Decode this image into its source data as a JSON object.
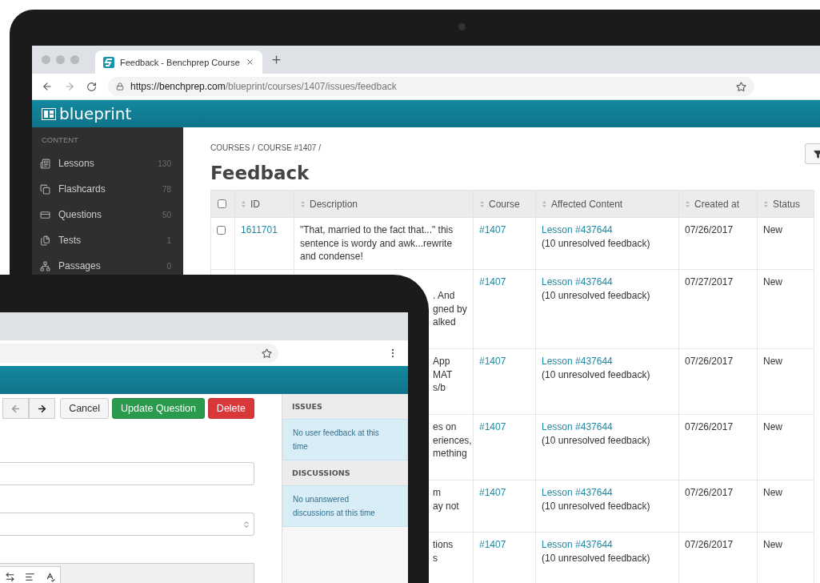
{
  "laptop": {
    "browser": {
      "tab_title": "Feedback - Benchprep Course",
      "url_host": "https://benchprep.com",
      "url_path": "/blueprint/courses/1407/issues/feedback"
    },
    "app": {
      "logo": "blueprint"
    },
    "sidebar": {
      "heading": "CONTENT",
      "items": [
        {
          "label": "Lessons",
          "count": "130"
        },
        {
          "label": "Flashcards",
          "count": "78"
        },
        {
          "label": "Questions",
          "count": "50"
        },
        {
          "label": "Tests",
          "count": "1"
        },
        {
          "label": "Passages",
          "count": "0"
        }
      ]
    },
    "breadcrumb": [
      "COURSES /",
      "COURSE #1407 /"
    ],
    "title": "Feedback",
    "table": {
      "select_all": {
        "checked": false
      },
      "columns": [
        "ID",
        "Description",
        "Course",
        "Affected Content",
        "Created at",
        "Status"
      ],
      "rows": [
        {
          "kind": "full",
          "checked": false,
          "id": "1611701",
          "description": [
            "\"That, married to the fact that...\" this sentence is wordy and awk...rewrite and condense!"
          ],
          "course": "#1407",
          "lesson": "Lesson #437644",
          "note": "(10 unresolved feedback)",
          "created": "07/26/2017",
          "status": "New"
        },
        {
          "kind": "partial",
          "description": [
            ". And",
            "gned by",
            "alked"
          ],
          "course": "#1407",
          "lesson": "Lesson #437644",
          "note": "(10 unresolved feedback)",
          "created": "07/27/2017",
          "status": "New"
        },
        {
          "kind": "partial",
          "description": [
            "App",
            "MAT",
            "s/b"
          ],
          "course": "#1407",
          "lesson": "Lesson #437644",
          "note": "(10 unresolved feedback)",
          "created": "07/26/2017",
          "status": "New"
        },
        {
          "kind": "partial",
          "description": [
            "es on",
            "eriences,",
            "mething"
          ],
          "course": "#1407",
          "lesson": "Lesson #437644",
          "note": "(10 unresolved feedback)",
          "created": "07/26/2017",
          "status": "New"
        },
        {
          "kind": "partial",
          "description": [
            "m",
            "ay not"
          ],
          "course": "#1407",
          "lesson": "Lesson #437644",
          "note": "(10 unresolved feedback)",
          "created": "07/26/2017",
          "status": "New"
        },
        {
          "kind": "partial",
          "description": [
            "tions",
            "s"
          ],
          "course": "#1407",
          "lesson": "Lesson #437644",
          "note": "(10 unresolved feedback)",
          "created": "07/26/2017",
          "status": "New"
        }
      ]
    }
  },
  "tablet": {
    "buttons": [
      {
        "label": "Cancel",
        "kind": "default"
      },
      {
        "label": "Update Question",
        "kind": "success"
      },
      {
        "label": "Delete",
        "kind": "danger"
      }
    ],
    "panels": [
      {
        "heading": "ISSUES",
        "message": "No user feedback at this time"
      },
      {
        "heading": "DISCUSSIONS",
        "message": "No unanswered discussions at this time"
      }
    ]
  }
}
